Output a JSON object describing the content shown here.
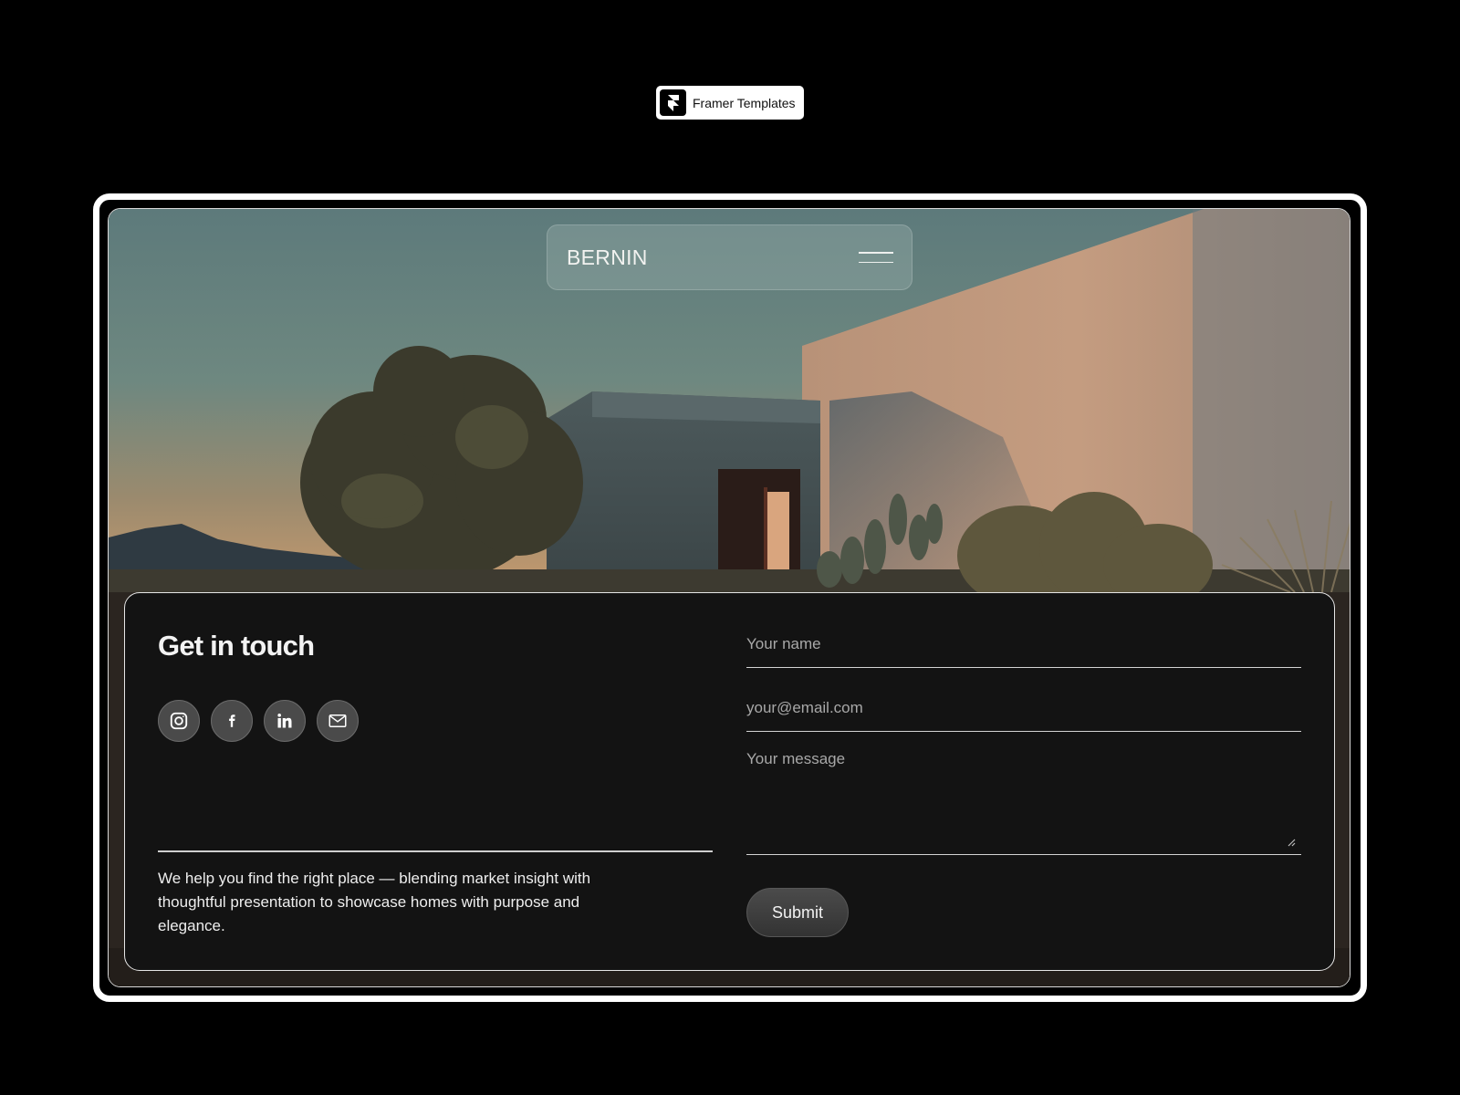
{
  "badge": {
    "label": "Framer Templates",
    "icon": "framer-logo-icon"
  },
  "nav": {
    "brand": "BERNIN",
    "menu_icon": "hamburger-menu-icon"
  },
  "contact": {
    "title": "Get in touch",
    "socials": [
      {
        "name": "instagram",
        "icon": "instagram-icon"
      },
      {
        "name": "facebook",
        "icon": "facebook-icon"
      },
      {
        "name": "linkedin",
        "icon": "linkedin-icon"
      },
      {
        "name": "email",
        "icon": "mail-icon"
      }
    ],
    "description": "We help you find the right place — blending market insight with thoughtful presentation to showcase homes with purpose and elegance.",
    "form": {
      "name_placeholder": "Your name",
      "email_placeholder": "your@email.com",
      "message_placeholder": "Your message",
      "submit_label": "Submit"
    }
  },
  "colors": {
    "background": "#000000",
    "card": "#131313",
    "social_button": "#4a4a4a"
  }
}
